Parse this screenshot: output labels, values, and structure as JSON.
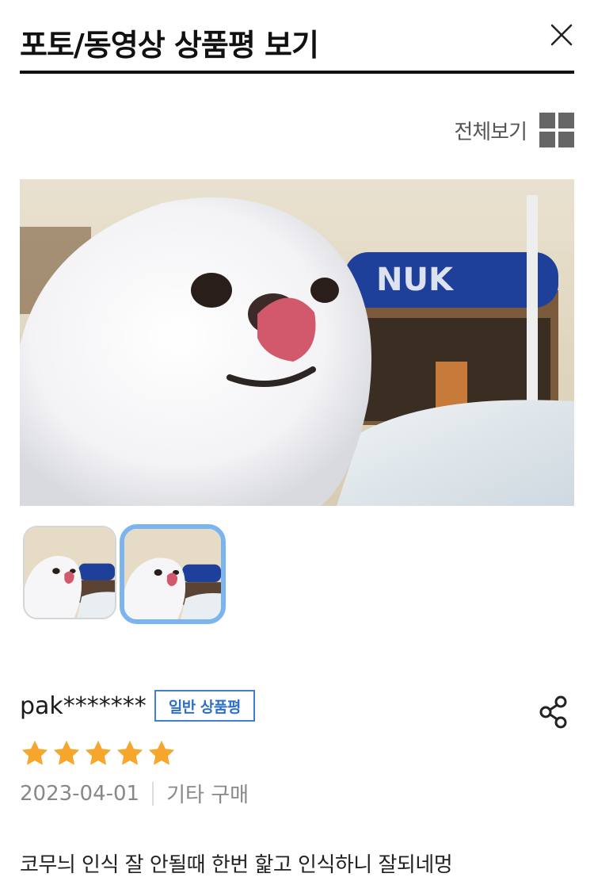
{
  "header": {
    "title": "포토/동영상 상품평 보기",
    "close_icon": "close-icon"
  },
  "view_all": {
    "label": "전체보기",
    "icon": "grid-icon"
  },
  "photos": {
    "main_alt": "white dog licking nose",
    "thumbnails": [
      {
        "selected": false
      },
      {
        "selected": true
      }
    ],
    "selected_border_color": "#7cb4ef"
  },
  "review": {
    "reviewer": "pak*******",
    "badge": "일반 상품평",
    "rating": 5,
    "max_rating": 5,
    "date": "2023-04-01",
    "purchase_type": "기타 구매",
    "text": "코무늬 인식 잘 안될때 한번 핥고 인식하니  잘되네멍",
    "share_icon": "share-icon"
  },
  "colors": {
    "star": "#f7a62d",
    "badge": "#2f6fc8",
    "title_rule": "#111111"
  }
}
